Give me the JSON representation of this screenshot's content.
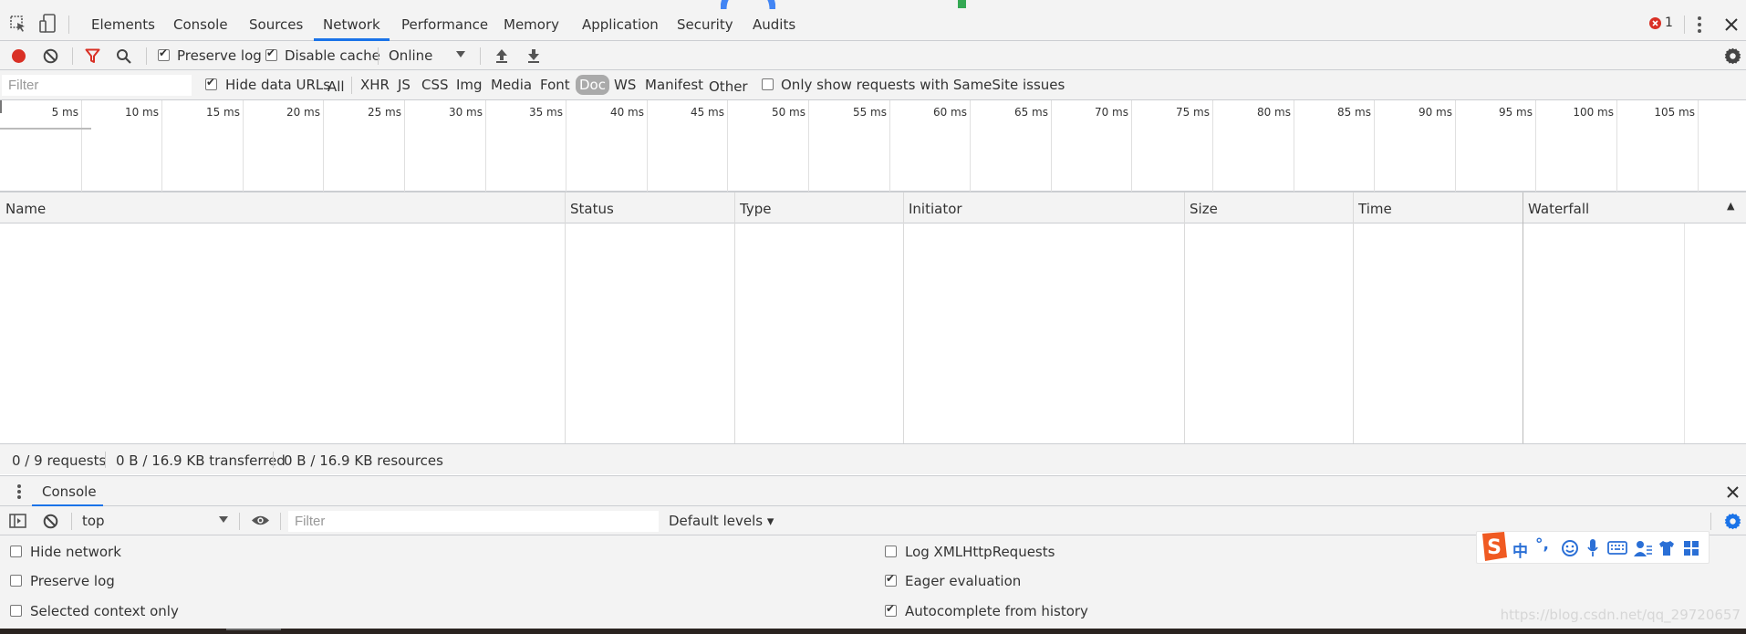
{
  "tabs": [
    "Elements",
    "Console",
    "Sources",
    "Network",
    "Performance",
    "Memory",
    "Application",
    "Security",
    "Audits"
  ],
  "active_tab": "Network",
  "error_count": "1",
  "toolbar": {
    "preserve_log_label": "Preserve log",
    "preserve_log_checked": true,
    "disable_cache_label": "Disable cache",
    "disable_cache_checked": true,
    "throttling_value": "Online"
  },
  "filter_bar": {
    "filter_placeholder": "Filter",
    "hide_data_urls_label": "Hide data URLs",
    "hide_data_urls_checked": true,
    "types": [
      "All",
      "XHR",
      "JS",
      "CSS",
      "Img",
      "Media",
      "Font",
      "Doc",
      "WS",
      "Manifest",
      "Other"
    ],
    "selected_type": "Doc",
    "samesite_label": "Only show requests with SameSite issues",
    "samesite_checked": false
  },
  "overview": {
    "tick_labels": [
      "5 ms",
      "10 ms",
      "15 ms",
      "20 ms",
      "25 ms",
      "30 ms",
      "35 ms",
      "40 ms",
      "45 ms",
      "50 ms",
      "55 ms",
      "60 ms",
      "65 ms",
      "70 ms",
      "75 ms",
      "80 ms",
      "85 ms",
      "90 ms",
      "95 ms",
      "100 ms",
      "105 ms",
      "1"
    ]
  },
  "grid": {
    "columns": [
      "Name",
      "Status",
      "Type",
      "Initiator",
      "Size",
      "Time",
      "Waterfall"
    ],
    "sort_indicator": "▲"
  },
  "status_bar": {
    "requests": "0 / 9 requests",
    "transferred": "0 B / 16.9 KB transferred",
    "resources": "0 B / 16.9 KB resources"
  },
  "drawer": {
    "tab_label": "Console",
    "context_value": "top",
    "filter_placeholder": "Filter",
    "levels_label": "Default levels ▾",
    "left_options": [
      {
        "label": "Hide network",
        "checked": false
      },
      {
        "label": "Preserve log",
        "checked": false
      },
      {
        "label": "Selected context only",
        "checked": false
      }
    ],
    "right_options": [
      {
        "label": "Log XMLHttpRequests",
        "checked": false
      },
      {
        "label": "Eager evaluation",
        "checked": true
      },
      {
        "label": "Autocomplete from history",
        "checked": true
      }
    ]
  },
  "ime_toolbar": {
    "chars": [
      "中",
      "°,"
    ]
  },
  "watermark": "https://blog.csdn.net/qq_29720657",
  "colors": {
    "accent": "#1a73e8",
    "record": "#d93025",
    "filter_icon": "#d93025",
    "error": "#d93025",
    "ime_brand": "#f05a22",
    "ime_icons": "#2a6fd6"
  }
}
